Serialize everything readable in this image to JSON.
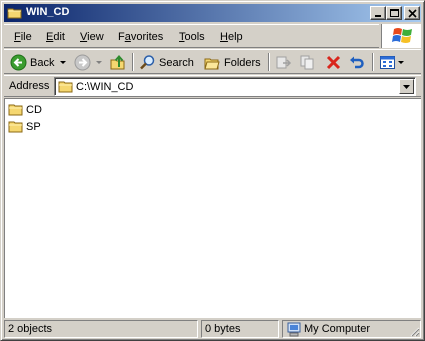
{
  "window": {
    "title": "WIN_CD",
    "title_icon": "folder-icon",
    "controls": [
      "minimize-icon",
      "maximize-icon",
      "close-icon"
    ]
  },
  "menu": [
    {
      "label": "File",
      "key": "F",
      "rest": "ile"
    },
    {
      "label": "Edit",
      "key": "E",
      "rest": "dit"
    },
    {
      "label": "View",
      "key": "V",
      "rest": "iew"
    },
    {
      "label": "Favorites",
      "key": "a",
      "pre": "F",
      "rest": "vorites"
    },
    {
      "label": "Tools",
      "key": "T",
      "rest": "ools"
    },
    {
      "label": "Help",
      "key": "H",
      "rest": "elp"
    }
  ],
  "toolbar": {
    "back_label": "Back",
    "search_label": "Search",
    "folders_label": "Folders",
    "icons": [
      "back-icon",
      "forward-icon",
      "up-folder-icon",
      "search-icon",
      "folders-icon",
      "move-to-icon",
      "copy-to-icon",
      "delete-icon",
      "undo-icon",
      "views-icon"
    ]
  },
  "address": {
    "label": "Address",
    "value": "C:\\WIN_CD"
  },
  "files": [
    {
      "name": "CD",
      "icon": "folder-icon"
    },
    {
      "name": "SP",
      "icon": "folder-icon"
    }
  ],
  "status": {
    "objects": "2 objects",
    "size": "0 bytes",
    "location": "My Computer",
    "location_icon": "my-computer-icon"
  },
  "colors": {
    "titlebar_start": "#0a246a",
    "titlebar_end": "#a6caf0",
    "chrome": "#d4d0c8",
    "folder": "#f5d770"
  }
}
